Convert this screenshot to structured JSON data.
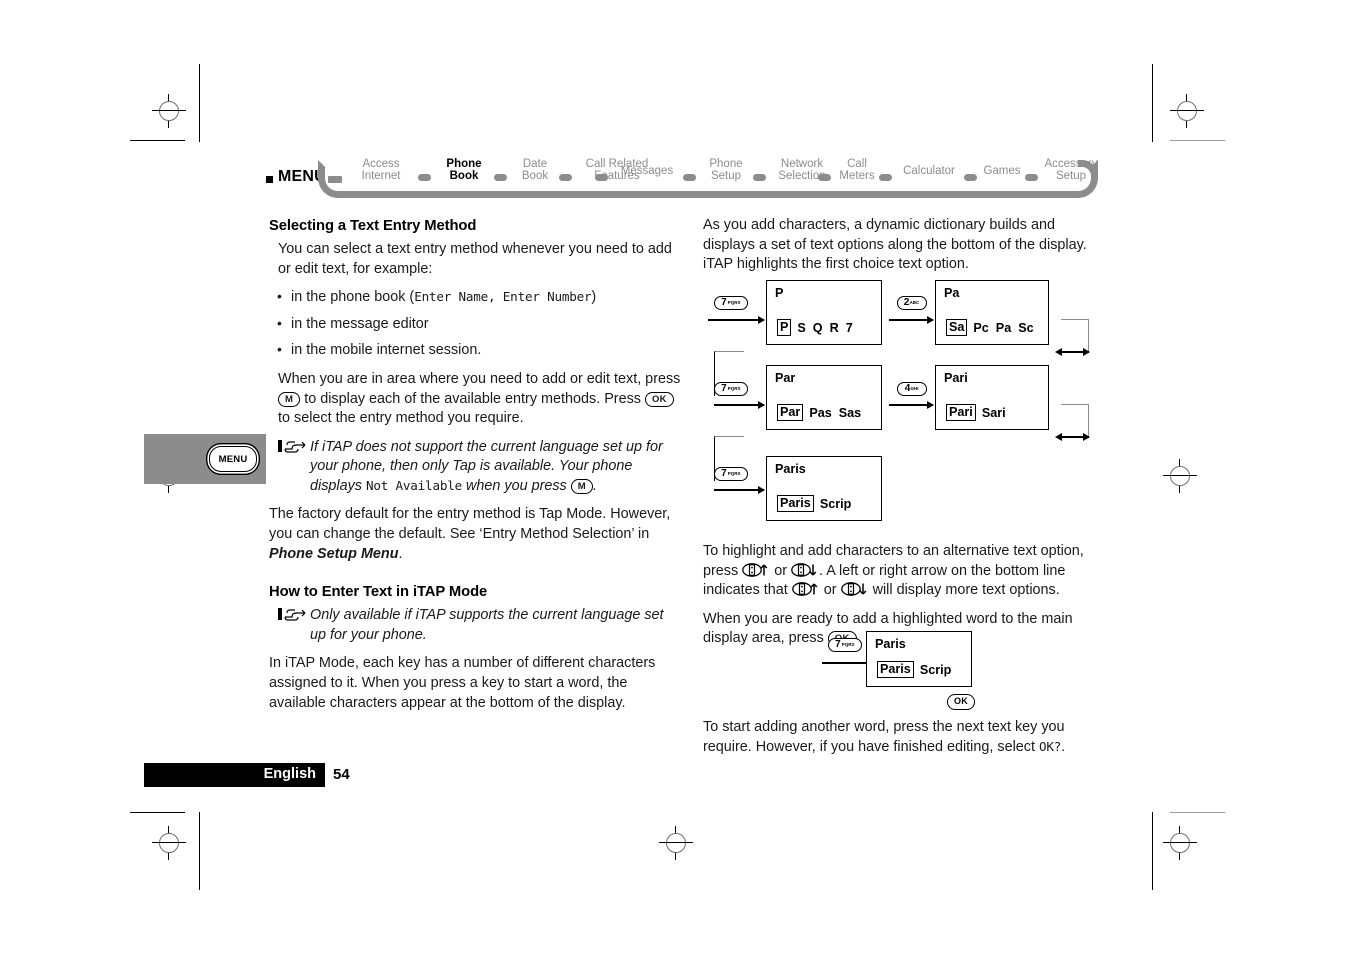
{
  "nav": {
    "menu_label": "MENU",
    "items": [
      {
        "label": "Access\nInternet",
        "current": false
      },
      {
        "label": "Phone\nBook",
        "current": true
      },
      {
        "label": "Date\nBook",
        "current": false
      },
      {
        "label": "Call Related\nFeatures",
        "current": false
      },
      {
        "label": "Messages",
        "current": false
      },
      {
        "label": "Phone\nSetup",
        "current": false
      },
      {
        "label": "Network\nSelection",
        "current": false
      },
      {
        "label": "Call\nMeters",
        "current": false
      },
      {
        "label": "Calculator",
        "current": false
      },
      {
        "label": "Games",
        "current": false
      },
      {
        "label": "Accessory\nSetup",
        "current": false
      }
    ],
    "accent_gray": "#8c8c8c"
  },
  "side_tab": {
    "button_label": "MENU"
  },
  "left_column": {
    "heading1": "Selecting a Text Entry Method",
    "para1": "You can select a text entry method whenever you need to add or edit text, for example:",
    "bullet1_pre": "in the phone book (",
    "bullet1_code": "Enter Name, Enter Number",
    "bullet1_post": ")",
    "bullet2": "in the message editor",
    "bullet3": "in the mobile internet session.",
    "para2_a": "When you are in area where you need to add or edit text, press ",
    "para2_key1": "M",
    "para2_b": " to display each of the available entry methods. Press ",
    "para2_key2": "OK",
    "para2_c": " to select the entry method you require.",
    "note1_a": "If iTAP does not support the current language set up for your phone, then only Tap is available. Your phone displays ",
    "note1_code": "Not Available",
    "note1_b": " when you press ",
    "note1_key": "M",
    "note1_c": ".",
    "para3_a": "The factory default for the entry method is Tap Mode. However, you can change the default. See ‘Entry Method Selection’ in ",
    "para3_bold": "Phone Setup Menu",
    "para3_b": ".",
    "heading2": "How to Enter Text in iTAP Mode",
    "note2": "Only available if iTAP supports the current language set up for your phone.",
    "para4": "In iTAP Mode, each key has a number of different characters assigned to it. When you press a key to start a word, the available characters appear at the bottom of the display."
  },
  "right_column": {
    "para1": "As you add characters, a dynamic dictionary builds and displays a set of text options along the bottom of the display. iTAP highlights the first choice text option.",
    "para2_a": "To highlight and add characters to an alternative text option, press ",
    "para2_b": " or ",
    "para2_c": ". A left or right arrow on the bottom line indicates that ",
    "para2_d": " or ",
    "para2_e": " will display more text options.",
    "para3_a": "When you are ready to add a highlighted word to the main display area, press ",
    "para3_key": "OK",
    "para3_b": ".",
    "para4_a": "To start adding another word, press the next text key you require. However, if you have finished editing, select ",
    "para4_code": "OK?",
    "para4_b": "."
  },
  "sequence": {
    "steps": [
      {
        "key_num": "7",
        "key_sub": "PQRS",
        "display_top": "P",
        "highlight": "P",
        "options": "S  Q  R  7"
      },
      {
        "key_num": "2",
        "key_sub": "ABC",
        "display_top": "Pa",
        "highlight": "Sa",
        "options": "Pc  Pa  Sc"
      },
      {
        "key_num": "7",
        "key_sub": "PQRS",
        "display_top": "Par",
        "highlight": "Par",
        "options": "Pas  Sas"
      },
      {
        "key_num": "4",
        "key_sub": "GHI",
        "display_top": "Pari",
        "highlight": "Pari",
        "options": "Sari"
      },
      {
        "key_num": "7",
        "key_sub": "PQRS",
        "display_top": "Paris",
        "highlight": "Paris",
        "options": "Scrip"
      }
    ],
    "final": {
      "key_num": "7",
      "key_sub": "PQRS",
      "display_top": "Paris",
      "highlight": "Paris",
      "options": "Scrip",
      "ok_label": "OK"
    }
  },
  "footer": {
    "language": "English",
    "page_number": "54"
  }
}
